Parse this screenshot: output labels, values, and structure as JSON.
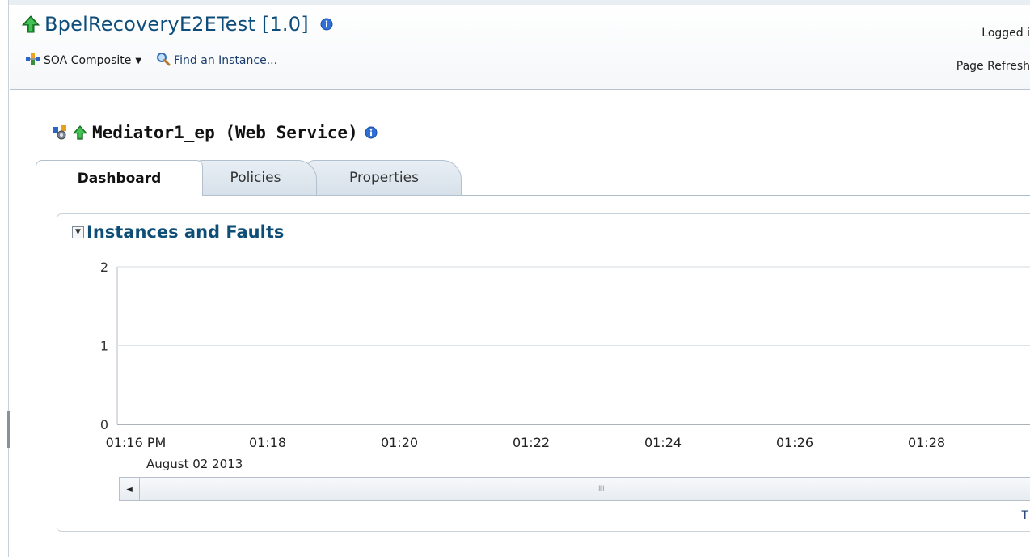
{
  "header": {
    "title": "BpelRecoveryE2ETest [1.0]",
    "toolbar": {
      "composite_label": "SOA Composite",
      "find_label": "Find an Instance..."
    },
    "logged_in_text": "Logged i",
    "page_refresh_text": "Page Refresh"
  },
  "section": {
    "title": "Mediator1_ep (Web Service)"
  },
  "tabs": [
    {
      "label": "Dashboard",
      "active": true
    },
    {
      "label": "Policies",
      "active": false
    },
    {
      "label": "Properties",
      "active": false
    }
  ],
  "panel": {
    "title": "Instances and Faults"
  },
  "chart_data": {
    "type": "line",
    "title": "",
    "xlabel": "",
    "ylabel": "",
    "x_ticks": [
      "01:16 PM",
      "01:18",
      "01:20",
      "01:22",
      "01:24",
      "01:26",
      "01:28"
    ],
    "x_sublabel": "August 02 2013",
    "y_ticks": [
      "0",
      "1",
      "2"
    ],
    "ylim": [
      0,
      2
    ],
    "grid": true,
    "series": []
  },
  "scroll": {
    "left_arrow": "◄",
    "grip": "IIII"
  },
  "footer_partial": "T",
  "icons": {
    "status": "up-arrow-green",
    "info": "info-icon-blue",
    "composite": "composite-icon",
    "search": "magnifier-icon",
    "service": "web-service-icon"
  }
}
